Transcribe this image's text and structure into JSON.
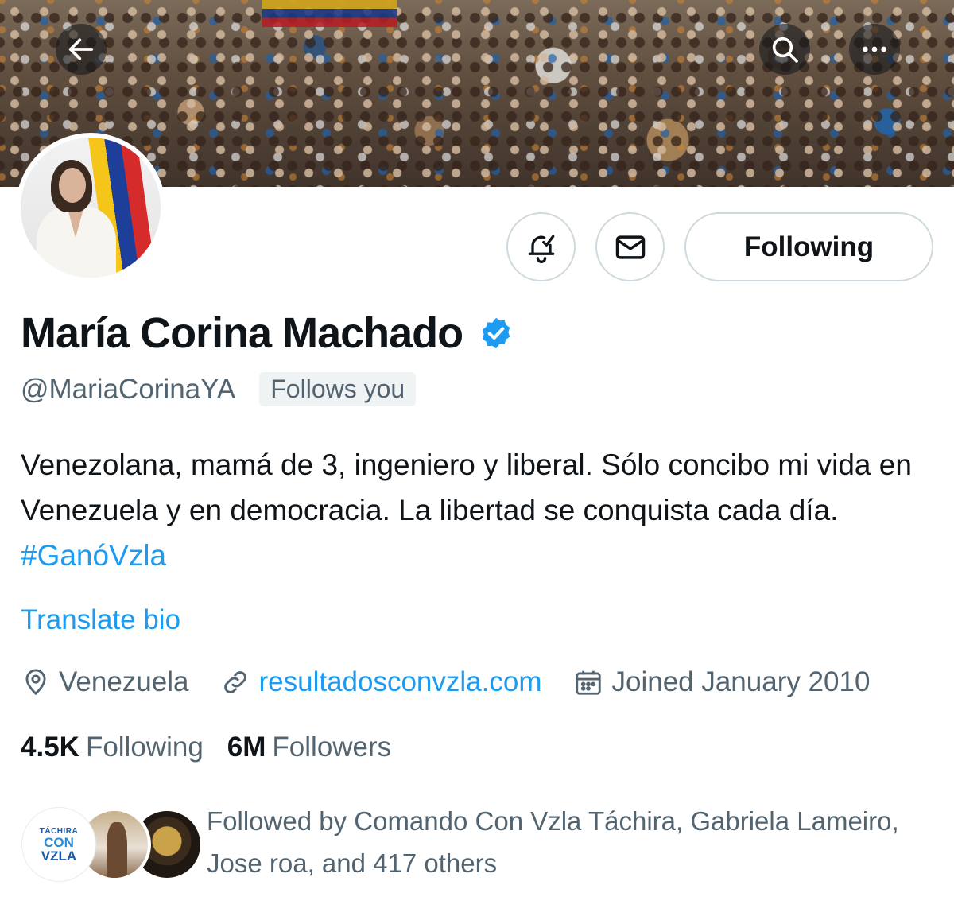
{
  "header": {
    "back_icon": "arrow-left-icon",
    "search_icon": "search-icon",
    "more_icon": "more-horizontal-icon"
  },
  "actions": {
    "notify_icon": "bell-check-icon",
    "message_icon": "envelope-icon",
    "following_label": "Following"
  },
  "profile": {
    "display_name": "María Corina Machado",
    "verified": true,
    "handle": "@MariaCorinaYA",
    "follows_you": "Follows you",
    "bio_text": "Venezolana, mamá de 3, ingeniero y liberal. Sólo concibo mi vida en Venezuela y en democracia. La libertad se conquista cada día.",
    "bio_hashtag": "#GanóVzla",
    "translate_label": "Translate bio",
    "location": "Venezuela",
    "website": "resultadosconvzla.com",
    "joined": "Joined January 2010"
  },
  "stats": {
    "following_count": "4.5K",
    "following_label": "Following",
    "followers_count": "6M",
    "followers_label": "Followers"
  },
  "followed_by": {
    "text": "Followed by Comando Con Vzla Táchira, Gabriela Lameiro, Jose roa, and 417 others",
    "avatar_1_text": {
      "line1": "TÁCHIRA",
      "line2": "CON",
      "line3": "VZLA"
    }
  },
  "colors": {
    "accent": "#1d9bf0",
    "text_primary": "#0f1419",
    "text_secondary": "#536471",
    "border": "#cfd9de",
    "badge_bg": "#eff3f4"
  }
}
